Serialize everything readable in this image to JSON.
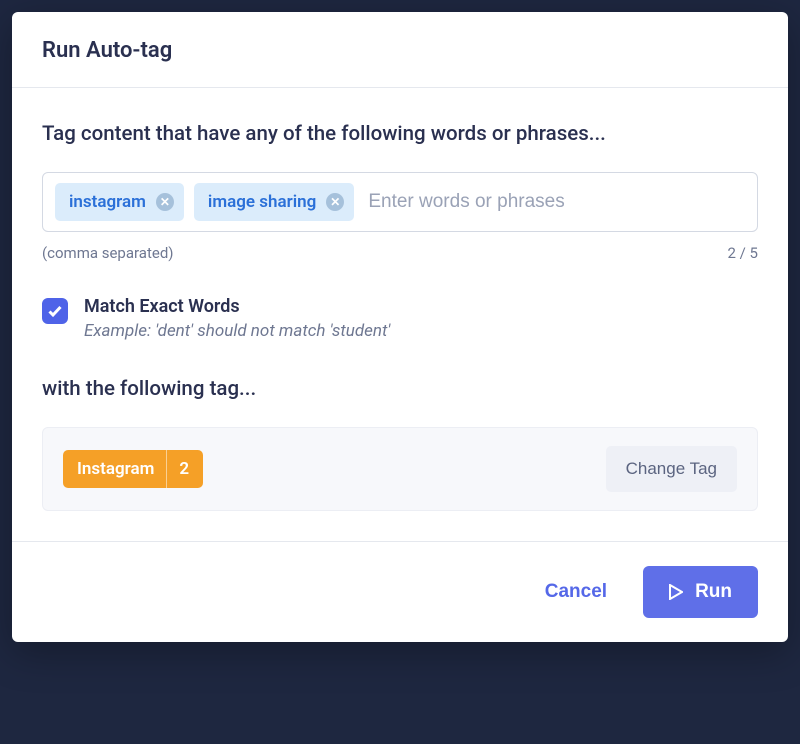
{
  "modal": {
    "title": "Run Auto-tag"
  },
  "wordsSection": {
    "label": "Tag content that have any of the following words or phrases...",
    "chips": [
      "instagram",
      "image sharing"
    ],
    "placeholder": "Enter words or phrases",
    "hintLeft": "(comma separated)",
    "hintRight": "2 / 5"
  },
  "matchExact": {
    "checked": true,
    "title": "Match Exact Words",
    "example": "Example: 'dent' should not match 'student'"
  },
  "tagSection": {
    "label": "with the following tag...",
    "tagName": "Instagram",
    "tagCount": "2",
    "changeButton": "Change Tag"
  },
  "footer": {
    "cancel": "Cancel",
    "run": "Run"
  }
}
